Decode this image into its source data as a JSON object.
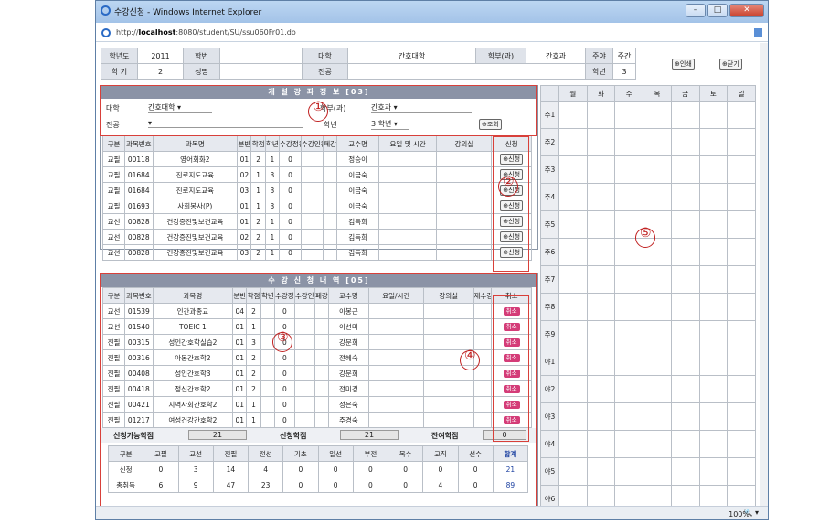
{
  "window": {
    "title": "수강신청 - Windows Internet Explorer",
    "url_prefix": "http://",
    "url_host": "localhost",
    "url_rest": ":8080/student/SU/ssu060Fr01.do"
  },
  "info": {
    "year_label": "학년도",
    "year_value": "2011",
    "term_label": "학 기",
    "term_value": "2",
    "student_id_label": "학번",
    "student_id_value": "",
    "name_label": "성명",
    "name_value": "",
    "college_label": "대학",
    "college_value": "간호대학",
    "major_label": "전공",
    "major_value": "",
    "dept_label": "학부(과)",
    "dept_value": "간호과",
    "daynight_label": "주야",
    "daynight_value": "주간",
    "grade_label": "학년",
    "grade_value": "3",
    "print_button": "인쇄",
    "close_button": "닫기"
  },
  "offered": {
    "title": "개 설 강 좌 정 보 [03]",
    "college_label": "대학",
    "college_value": "간호대학",
    "dept_label": "학부(과)",
    "dept_value": "간호과",
    "major_label": "전공",
    "major_value": "",
    "grade_label": "학년",
    "grade_value": "3 학년",
    "search_button": "조회",
    "headers": [
      "구분",
      "과목번호",
      "과목명",
      "분반",
      "학점",
      "학년",
      "수강정원",
      "수강인원",
      "폐강",
      "교수명",
      "요일 및 시간",
      "강의실",
      "신청"
    ],
    "apply_label": "신청",
    "rows": [
      [
        "교필",
        "00118",
        "영어회화2",
        "01",
        "2",
        "1",
        "0",
        "",
        "",
        "정승이",
        "",
        ""
      ],
      [
        "교필",
        "01684",
        "진로지도교육",
        "02",
        "1",
        "3",
        "0",
        "",
        "",
        "이금숙",
        "",
        ""
      ],
      [
        "교필",
        "01684",
        "진로지도교육",
        "03",
        "1",
        "3",
        "0",
        "",
        "",
        "이금숙",
        "",
        ""
      ],
      [
        "교필",
        "01693",
        "사회봉사(P)",
        "01",
        "1",
        "3",
        "0",
        "",
        "",
        "이금숙",
        "",
        ""
      ],
      [
        "교선",
        "00828",
        "건강증진및보건교육",
        "01",
        "2",
        "1",
        "0",
        "",
        "",
        "김득희",
        "",
        ""
      ],
      [
        "교선",
        "00828",
        "건강증진및보건교육",
        "02",
        "2",
        "1",
        "0",
        "",
        "",
        "김득희",
        "",
        ""
      ],
      [
        "교선",
        "00828",
        "건강증진및보건교육",
        "03",
        "2",
        "1",
        "0",
        "",
        "",
        "김득희",
        "",
        ""
      ]
    ]
  },
  "enrolled": {
    "title": "수 강 신 청 내 역 [05]",
    "headers": [
      "구분",
      "과목번호",
      "과목명",
      "분반",
      "학점",
      "학년",
      "수강정원",
      "수강인원",
      "폐강",
      "교수명",
      "요일/시간",
      "강의실",
      "재수강",
      "취소"
    ],
    "cancel_label": "취소",
    "rows": [
      [
        "교선",
        "01539",
        "인간과종교",
        "04",
        "2",
        "",
        "0",
        "",
        "",
        "이봉근",
        "",
        "",
        ""
      ],
      [
        "교선",
        "01540",
        "TOEIC 1",
        "01",
        "1",
        "",
        "0",
        "",
        "",
        "이선미",
        "",
        "",
        ""
      ],
      [
        "전필",
        "00315",
        "성인간호학실습2",
        "01",
        "3",
        "",
        "0",
        "",
        "",
        "강문희",
        "",
        "",
        ""
      ],
      [
        "전필",
        "00316",
        "아동간호학2",
        "01",
        "2",
        "",
        "0",
        "",
        "",
        "전혜숙",
        "",
        "",
        ""
      ],
      [
        "전필",
        "00408",
        "성인간호학3",
        "01",
        "2",
        "",
        "0",
        "",
        "",
        "강문희",
        "",
        "",
        ""
      ],
      [
        "전필",
        "00418",
        "정신간호학2",
        "01",
        "2",
        "",
        "0",
        "",
        "",
        "전미경",
        "",
        "",
        ""
      ],
      [
        "전필",
        "00421",
        "지역사회간호학2",
        "01",
        "1",
        "",
        "0",
        "",
        "",
        "정은숙",
        "",
        "",
        ""
      ],
      [
        "전필",
        "01217",
        "여성건강간호학2",
        "01",
        "1",
        "",
        "0",
        "",
        "",
        "주경숙",
        "",
        "",
        ""
      ]
    ],
    "credits": {
      "available_label": "신청가능학점",
      "available_value": "21",
      "applied_label": "신청학점",
      "applied_value": "21",
      "remaining_label": "잔여학점",
      "remaining_value": "0"
    },
    "summary": {
      "headers": [
        "구분",
        "교필",
        "교선",
        "전필",
        "전선",
        "기초",
        "일선",
        "부전",
        "복수",
        "교직",
        "선수",
        "합계"
      ],
      "rows": [
        [
          "신청",
          "0",
          "3",
          "14",
          "4",
          "0",
          "0",
          "0",
          "0",
          "0",
          "0",
          "21"
        ],
        [
          "총취득",
          "6",
          "9",
          "47",
          "23",
          "0",
          "0",
          "0",
          "0",
          "4",
          "0",
          "89"
        ]
      ]
    }
  },
  "timetable": {
    "days": [
      "월",
      "화",
      "수",
      "목",
      "금",
      "토",
      "일"
    ],
    "periods": [
      "주1",
      "주2",
      "주3",
      "주4",
      "주5",
      "주6",
      "주7",
      "주8",
      "주9",
      "야1",
      "야2",
      "야3",
      "야4",
      "야5",
      "야6"
    ]
  },
  "annotations": [
    "①",
    "②",
    "③",
    "④",
    "⑤"
  ],
  "statusbar": {
    "zoom": "100%"
  }
}
